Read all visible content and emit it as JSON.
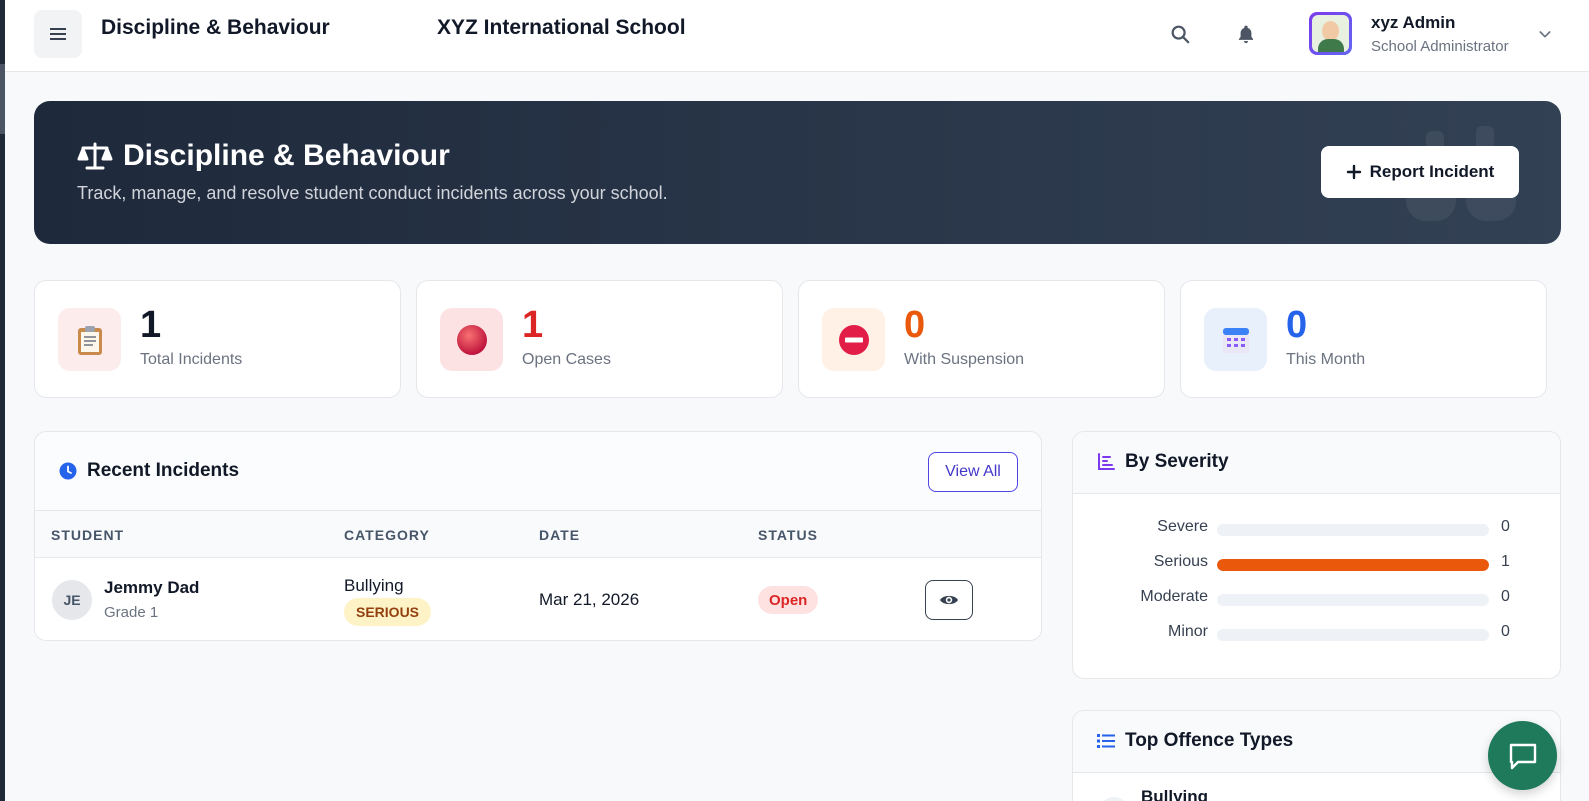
{
  "header": {
    "page_title": "Discipline & Behaviour",
    "school_name": "XYZ International School",
    "user": {
      "name": "xyz Admin",
      "role": "School Administrator"
    }
  },
  "hero": {
    "title": "Discipline & Behaviour",
    "subtitle": "Track, manage, and resolve student conduct incidents across your school.",
    "report_button": "Report Incident"
  },
  "stats": [
    {
      "value": "1",
      "label": "Total Incidents",
      "color": "#111827",
      "icon": "clipboard-icon"
    },
    {
      "value": "1",
      "label": "Open Cases",
      "color": "#dc2626",
      "icon": "red-circle-icon"
    },
    {
      "value": "0",
      "label": "With Suspension",
      "color": "#ea580c",
      "icon": "no-entry-icon"
    },
    {
      "value": "0",
      "label": "This Month",
      "color": "#2563eb",
      "icon": "calendar-icon"
    }
  ],
  "recent_incidents": {
    "title": "Recent Incidents",
    "view_all": "View All",
    "columns": [
      "STUDENT",
      "CATEGORY",
      "DATE",
      "STATUS"
    ],
    "rows": [
      {
        "initials": "JE",
        "student": "Jemmy Dad",
        "grade": "Grade 1",
        "category": "Bullying",
        "severity": "SERIOUS",
        "date": "Mar 21, 2026",
        "status": "Open"
      }
    ]
  },
  "by_severity": {
    "title": "By Severity",
    "levels": [
      {
        "name": "Severe",
        "count": "0",
        "fraction": 0
      },
      {
        "name": "Serious",
        "count": "1",
        "fraction": 1
      },
      {
        "name": "Moderate",
        "count": "0",
        "fraction": 0
      },
      {
        "name": "Minor",
        "count": "0",
        "fraction": 0
      }
    ]
  },
  "top_offence_types": {
    "title": "Top Offence Types",
    "items": [
      "Bullying"
    ]
  }
}
